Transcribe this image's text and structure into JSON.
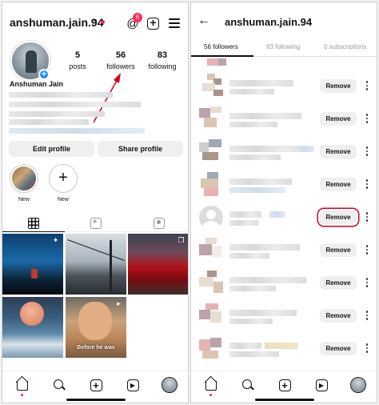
{
  "left": {
    "username": "anshuman.jain.94",
    "threads_badge": "6",
    "full_name": "Anshuman Jain",
    "stats": [
      {
        "value": "5",
        "label": "posts"
      },
      {
        "value": "56",
        "label": "followers"
      },
      {
        "value": "83",
        "label": "following"
      }
    ],
    "buttons": {
      "edit_profile": "Edit profile",
      "share_profile": "Share profile"
    },
    "highlights": [
      {
        "label": "New"
      },
      {
        "label": "New"
      }
    ],
    "post_caption": "Before he was"
  },
  "right": {
    "title": "anshuman.jain.94",
    "tabs": [
      {
        "label": "56 followers",
        "active": true
      },
      {
        "label": "83 following",
        "active": false
      },
      {
        "label": "0 subscriptions",
        "active": false
      }
    ],
    "remove_label": "Remove",
    "highlighted_row": 4
  },
  "colors": {
    "accent_red": "#d0021b",
    "badge_red": "#ff2d55",
    "verified_blue": "#1a8cff"
  },
  "icons": [
    "back-arrow-icon",
    "chevron-down-icon",
    "threads-icon",
    "add-icon",
    "menu-icon",
    "grid-icon",
    "reels-icon",
    "tagged-icon",
    "home-icon",
    "search-icon",
    "profile-icon",
    "more-options-icon"
  ]
}
